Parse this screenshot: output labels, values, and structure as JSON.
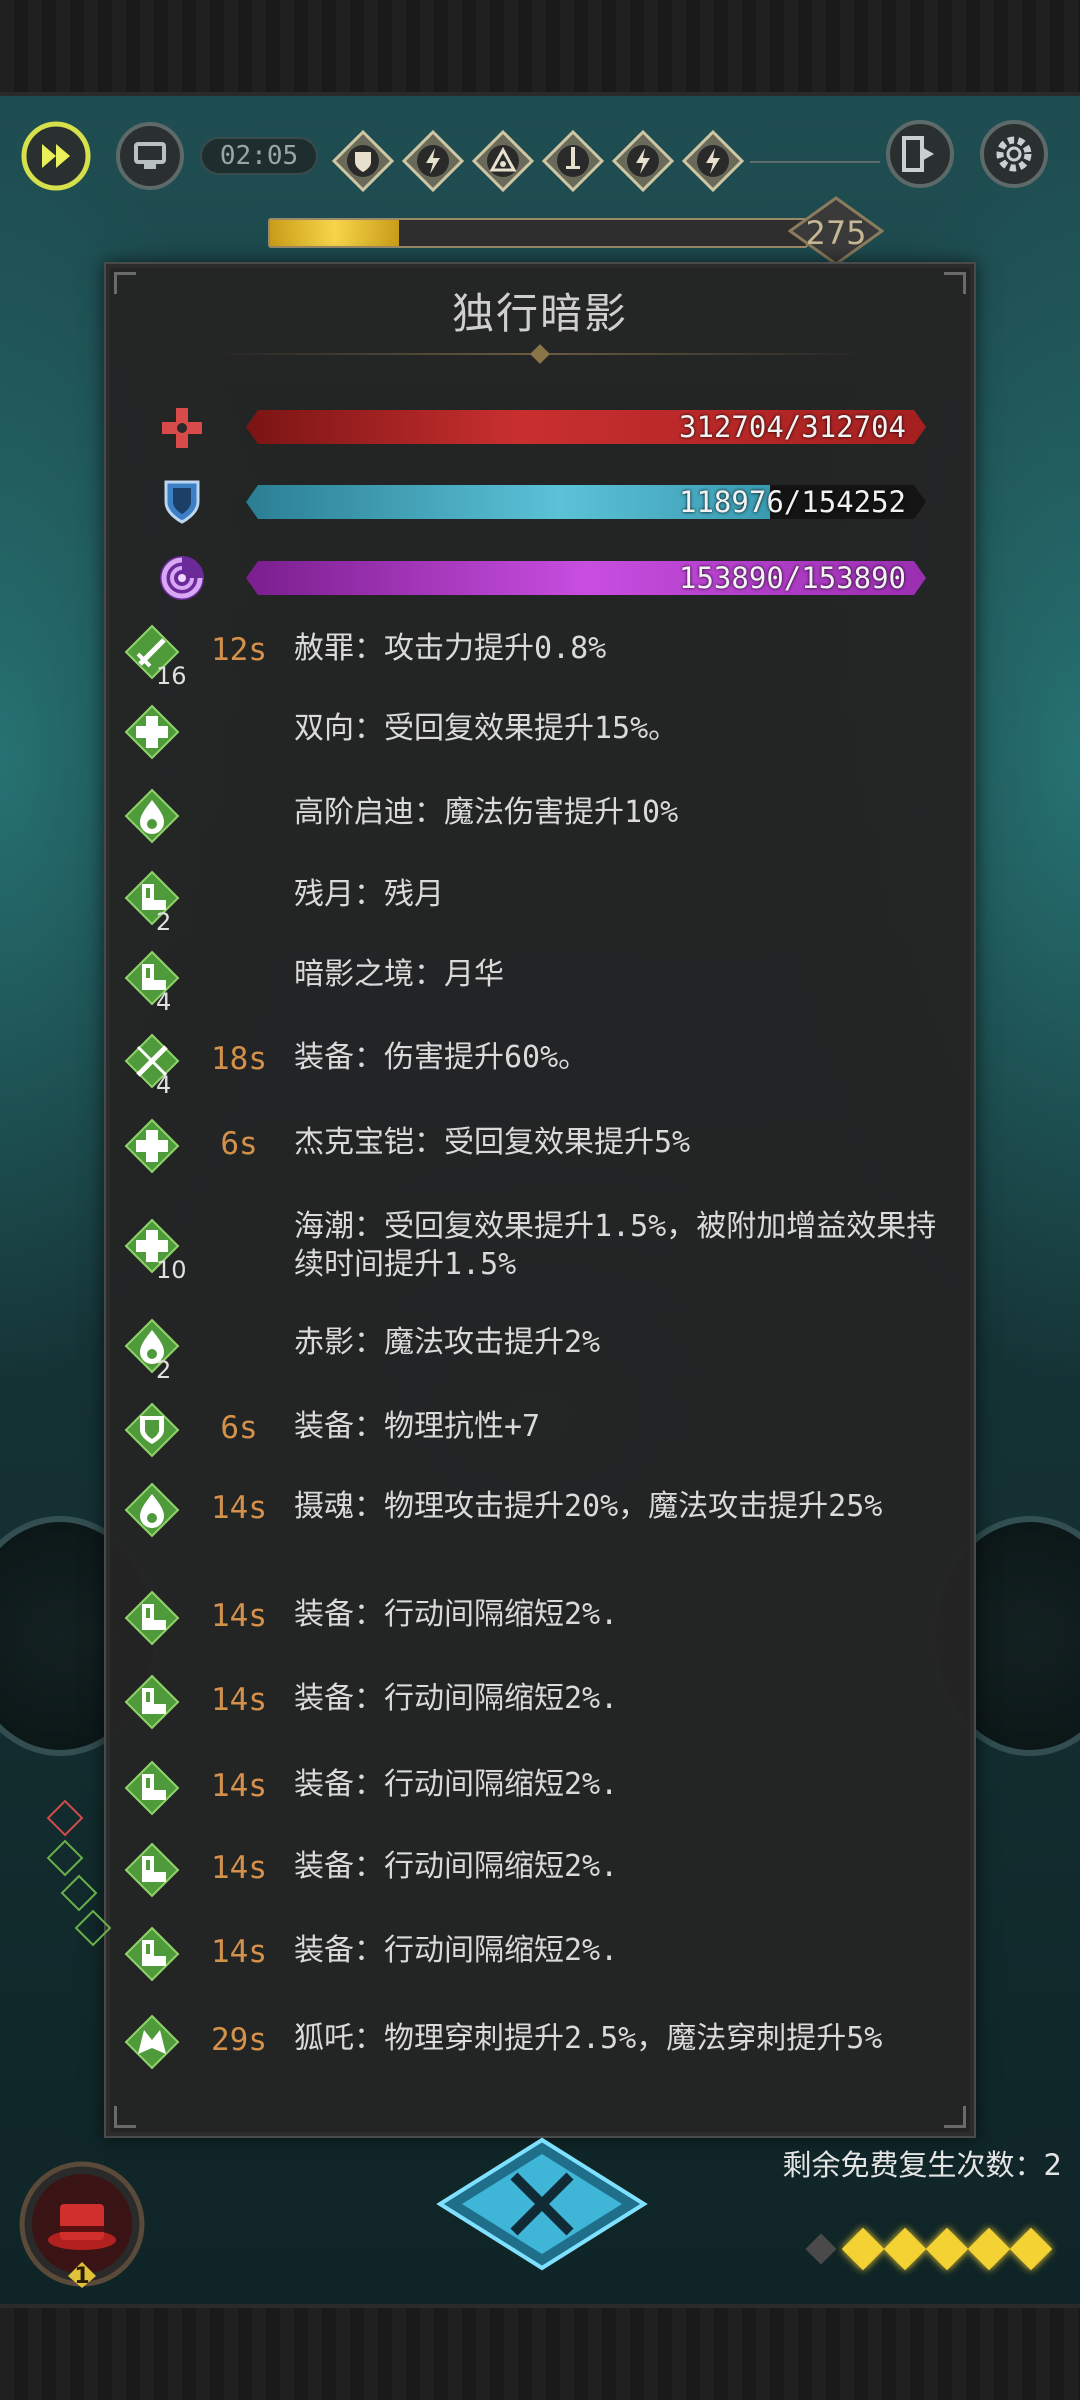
{
  "hud": {
    "timer": "02:05",
    "level": "275",
    "xp_fraction": 0.24,
    "top_buffs": [
      "shield-rune-icon",
      "lightning-rune-icon",
      "eye-rune-icon",
      "sword-rune-icon",
      "lightning-rune-icon",
      "lightning-rune-icon"
    ]
  },
  "panel": {
    "title": "独行暗影",
    "stats": [
      {
        "icon": "health-cross-icon",
        "text": "312704/312704",
        "fraction": 1.0,
        "color": "#c0392b"
      },
      {
        "icon": "shield-icon",
        "text": "118976/154252",
        "fraction": 0.771,
        "color": "#4aa3b8"
      },
      {
        "icon": "mana-swirl-icon",
        "text": "153890/153890",
        "fraction": 1.0,
        "color": "#b43fc4"
      }
    ],
    "buffs": [
      {
        "icon": "sword-buff-icon",
        "count": "16",
        "duration": "12s",
        "text": "赦罪：攻击力提升0.8%"
      },
      {
        "icon": "heal-cross-buff-icon",
        "count": "",
        "duration": "",
        "text": "双向：受回复效果提升15%。"
      },
      {
        "icon": "magic-flame-buff-icon",
        "count": "",
        "duration": "",
        "text": "高阶启迪：魔法伤害提升10%"
      },
      {
        "icon": "boot-buff-icon",
        "count": "2",
        "duration": "",
        "text": "残月：残月"
      },
      {
        "icon": "boot-buff-icon",
        "count": "4",
        "duration": "",
        "text": "暗影之境：月华"
      },
      {
        "icon": "slash-buff-icon",
        "count": "4",
        "duration": "18s",
        "text": "装备：伤害提升60%。"
      },
      {
        "icon": "heal-cross-buff-icon",
        "count": "",
        "duration": "6s",
        "text": "杰克宝铠：受回复效果提升5%"
      },
      {
        "icon": "heal-cross-buff-icon",
        "count": "10",
        "duration": "",
        "text": "海潮：受回复效果提升1.5%，被附加增益效果持续时间提升1.5%"
      },
      {
        "icon": "magic-flame-buff-icon",
        "count": "2",
        "duration": "",
        "text": "赤影：魔法攻击提升2%"
      },
      {
        "icon": "shield-buff-icon",
        "count": "",
        "duration": "6s",
        "text": "装备：物理抗性+7"
      },
      {
        "icon": "magic-flame-buff-icon",
        "count": "",
        "duration": "14s",
        "text": "摄魂：物理攻击提升20%，魔法攻击提升25%"
      },
      {
        "icon": "boot-buff-icon",
        "count": "",
        "duration": "14s",
        "text": "装备：行动间隔缩短2%."
      },
      {
        "icon": "boot-buff-icon",
        "count": "",
        "duration": "14s",
        "text": "装备：行动间隔缩短2%."
      },
      {
        "icon": "boot-buff-icon",
        "count": "",
        "duration": "14s",
        "text": "装备：行动间隔缩短2%."
      },
      {
        "icon": "boot-buff-icon",
        "count": "",
        "duration": "14s",
        "text": "装备：行动间隔缩短2%."
      },
      {
        "icon": "boot-buff-icon",
        "count": "",
        "duration": "14s",
        "text": "装备：行动间隔缩短2%."
      },
      {
        "icon": "wolf-buff-icon",
        "count": "",
        "duration": "29s",
        "text": "狐吒：物理穿刺提升2.5%，魔法穿刺提升5%"
      }
    ]
  },
  "bottom": {
    "revive_label": "剩余免费复生次数：2",
    "hat_badge": "1",
    "energy_filled": 5,
    "energy_total": 6
  },
  "colors": {
    "buff_green": "#4f9a3a",
    "duration_orange": "#d4914a",
    "xp_gold": "#f6d54a"
  }
}
